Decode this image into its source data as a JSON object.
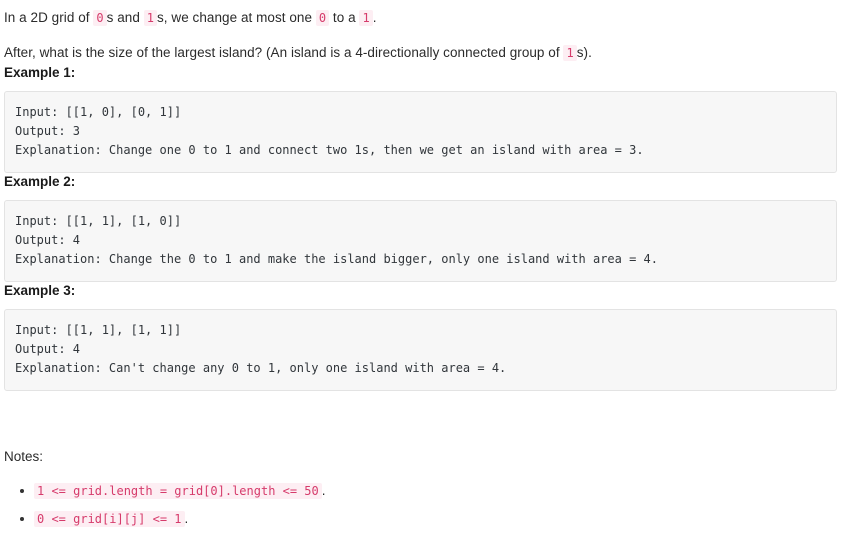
{
  "document": {
    "type": "problem-description",
    "intro": {
      "paragraph_1": {
        "segments": [
          {
            "type": "text",
            "value": "In a 2D grid of "
          },
          {
            "type": "code",
            "value": "0"
          },
          {
            "type": "text",
            "value": "s and "
          },
          {
            "type": "code",
            "value": "1"
          },
          {
            "type": "text",
            "value": "s, we change at most one "
          },
          {
            "type": "code",
            "value": "0"
          },
          {
            "type": "text",
            "value": " to a "
          },
          {
            "type": "code",
            "value": "1"
          },
          {
            "type": "text",
            "value": "."
          }
        ],
        "plain": "In a 2D grid of 0s and 1s, we change at most one 0 to a 1."
      },
      "paragraph_2": {
        "segments": [
          {
            "type": "text",
            "value": "After, what is the size of the largest island? (An island is a 4-directionally connected group of "
          },
          {
            "type": "code",
            "value": "1"
          },
          {
            "type": "text",
            "value": "s)."
          }
        ],
        "plain": "After, what is the size of the largest island? (An island is a 4-directionally connected group of 1s)."
      },
      "p1_t1": "In a 2D grid of ",
      "p1_c1": "0",
      "p1_t2": "s and ",
      "p1_c2": "1",
      "p1_t3": "s, we change at most one ",
      "p1_c3": "0",
      "p1_t4": " to a ",
      "p1_c4": "1",
      "p1_t5": ".",
      "p2_t1": "After, what is the size of the largest island? (An island is a 4-directionally connected group of ",
      "p2_c1": "1",
      "p2_t2": "s)."
    },
    "examples": [
      {
        "heading": "Example 1:",
        "input_label": "Input:",
        "input_value": "[[1, 0], [0, 1]]",
        "output_label": "Output:",
        "output_value": "3",
        "explanation_label": "Explanation:",
        "explanation_value": "Change one 0 to 1 and connect two 1s, then we get an island with area = 3.",
        "block": "Input: [[1, 0], [0, 1]]\nOutput: 3\nExplanation: Change one 0 to 1 and connect two 1s, then we get an island with area = 3."
      },
      {
        "heading": "Example 2:",
        "input_label": "Input:",
        "input_value": "[[1, 1], [1, 0]]",
        "output_label": "Output:",
        "output_value": "4",
        "explanation_label": "Explanation:",
        "explanation_value": "Change the 0 to 1 and make the island bigger, only one island with area = 4.",
        "block": "Input: [[1, 1], [1, 0]]\nOutput: 4\nExplanation: Change the 0 to 1 and make the island bigger, only one island with area = 4."
      },
      {
        "heading": "Example 3:",
        "input_label": "Input:",
        "input_value": "[[1, 1], [1, 1]]",
        "output_label": "Output:",
        "output_value": "4",
        "explanation_label": "Explanation:",
        "explanation_value": "Can't change any 0 to 1, only one island with area = 4.",
        "block": "Input: [[1, 1], [1, 1]]\nOutput: 4\nExplanation: Can't change any 0 to 1, only one island with area = 4."
      }
    ],
    "notes": {
      "label": "Notes:",
      "items": [
        {
          "code": "1 <= grid.length = grid[0].length <= 50",
          "suffix": "."
        },
        {
          "code": "0 <= grid[i][j] <= 1",
          "suffix": "."
        }
      ]
    },
    "colors": {
      "inline_code_text": "#d63b6b",
      "inline_code_bg": "#fdeef3",
      "codeblock_bg": "#f7f7f7",
      "codeblock_border": "#e3e3e3",
      "body_text": "#2b2b2b",
      "heading_text": "#1a1a1a",
      "page_bg": "#ffffff"
    }
  }
}
